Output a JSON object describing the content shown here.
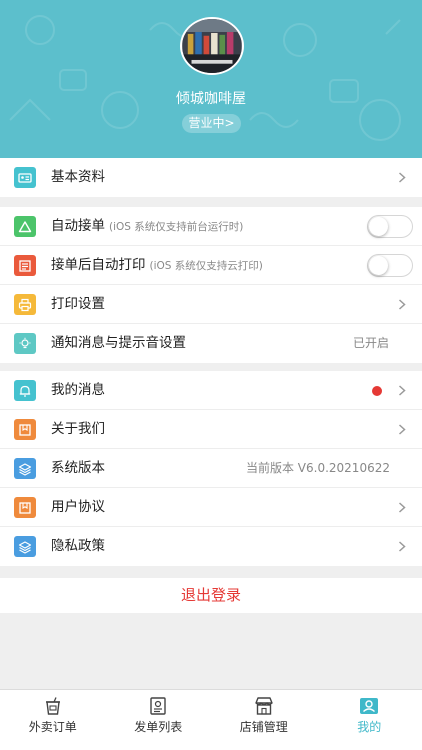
{
  "header": {
    "shop_name": "倾城咖啡屋",
    "status": "营业中>",
    "bg_color": "#5cbfcc"
  },
  "menu": {
    "basic_info": {
      "label": "基本资料",
      "icon": "id-card-icon"
    },
    "auto_accept": {
      "label": "自动接单",
      "note": "(iOS 系统仅支持前台运行时)",
      "icon": "triangle-icon",
      "enabled": false
    },
    "auto_print": {
      "label": "接单后自动打印",
      "note": "(iOS 系统仅支持云打印)",
      "icon": "printer-list-icon",
      "enabled": false
    },
    "print_settings": {
      "label": "打印设置",
      "icon": "printer-icon"
    },
    "notify_settings": {
      "label": "通知消息与提示音设置",
      "value": "已开启",
      "icon": "bulb-icon"
    },
    "my_messages": {
      "label": "我的消息",
      "icon": "bell-icon",
      "unread": true
    },
    "about_us": {
      "label": "关于我们",
      "icon": "book-icon"
    },
    "system_version": {
      "label": "系统版本",
      "value": "当前版本 V6.0.20210622",
      "icon": "layers-icon"
    },
    "user_agreement": {
      "label": "用户协议",
      "icon": "book-icon"
    },
    "privacy_policy": {
      "label": "隐私政策",
      "icon": "layers-icon"
    }
  },
  "logout_label": "退出登录",
  "tabs": [
    {
      "label": "外卖订单",
      "icon": "takeout-cup-icon",
      "active": false
    },
    {
      "label": "发单列表",
      "icon": "delivery-list-icon",
      "active": false
    },
    {
      "label": "店铺管理",
      "icon": "store-icon",
      "active": false
    },
    {
      "label": "我的",
      "icon": "profile-card-icon",
      "active": true
    }
  ],
  "colors": {
    "accent": "#3fb8c9",
    "danger": "#e53935",
    "icon_cyan": "#45c2cf",
    "icon_green": "#4cc46a",
    "icon_red": "#ea5a3c",
    "icon_yellow": "#f5b93a",
    "icon_teal": "#5ec8c4",
    "icon_orange": "#ef8a3c",
    "icon_blue": "#4a9de0"
  }
}
